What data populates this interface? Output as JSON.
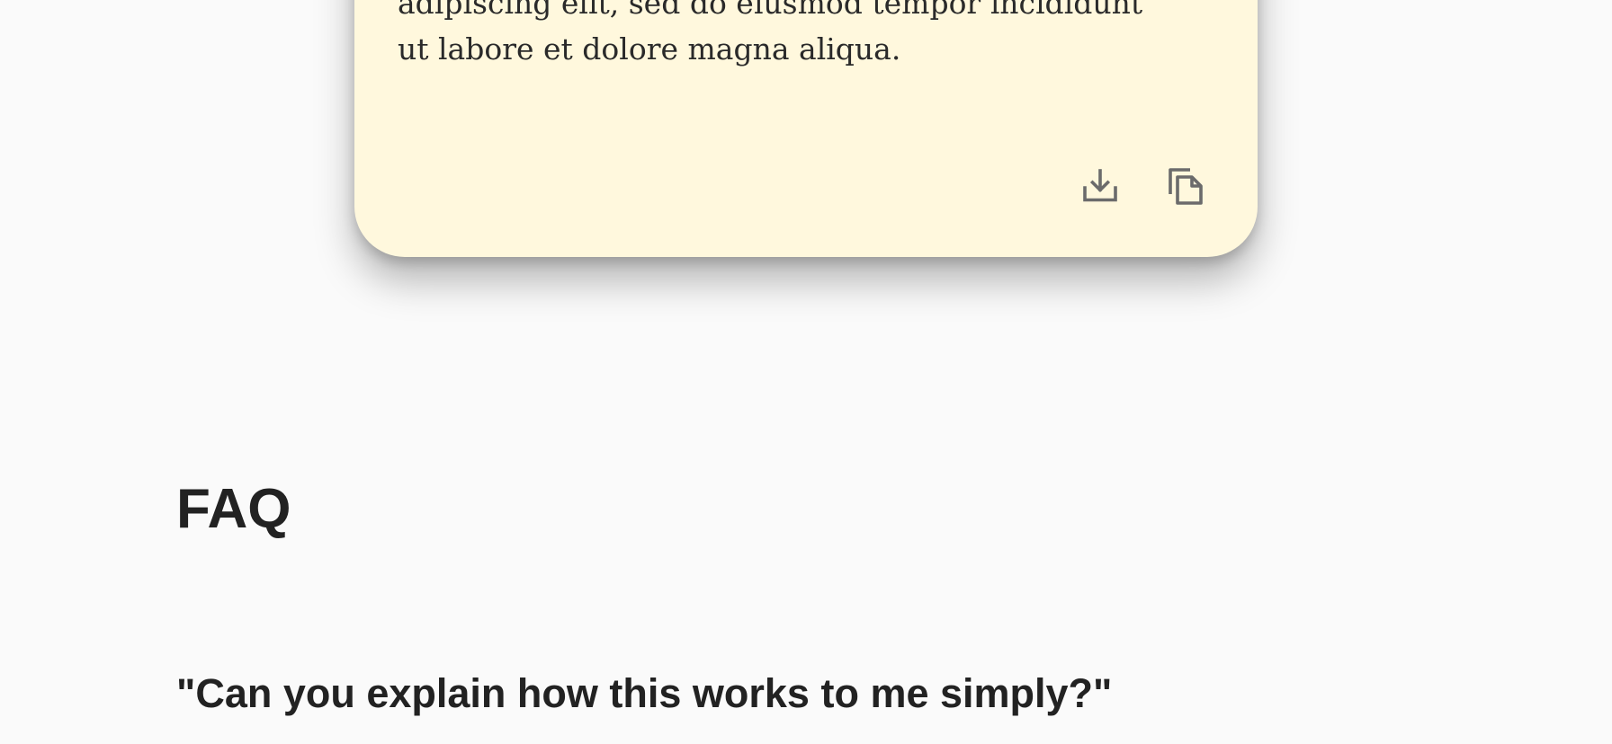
{
  "card": {
    "text_line_1": "adipiscing elit, sed do eiusmod tempor incididunt",
    "text_line_2": "ut labore et dolore magna aliqua.",
    "background": "#fff8dd",
    "icon_color": "#6b6b6b",
    "actions": [
      {
        "icon": "download-icon"
      },
      {
        "icon": "copy-icon"
      }
    ]
  },
  "faq": {
    "title": "FAQ",
    "questions": [
      {
        "text": "\"Can you explain how this works to me simply?\""
      }
    ]
  }
}
